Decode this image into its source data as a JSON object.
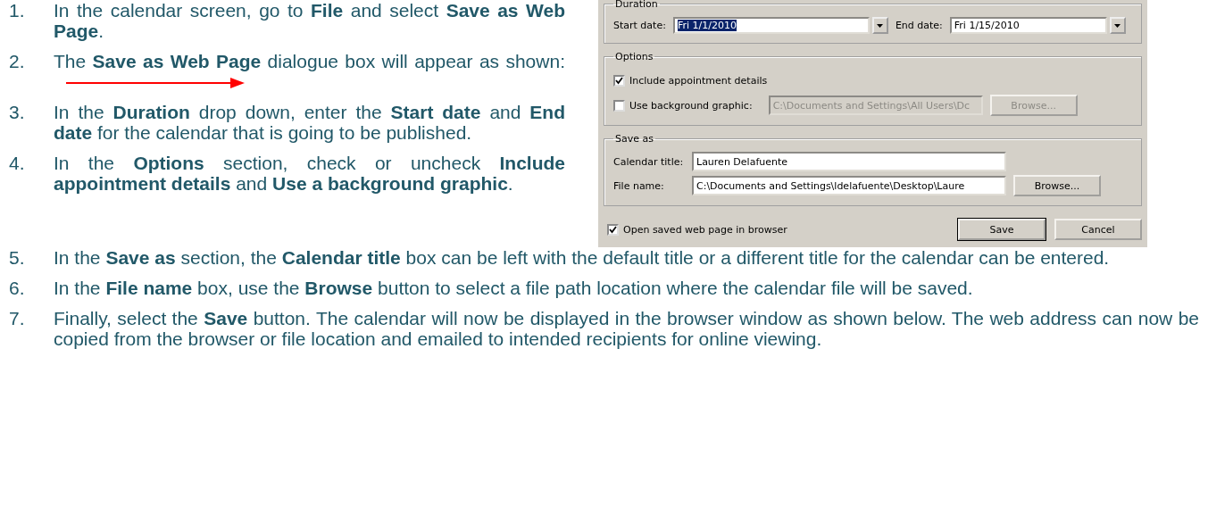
{
  "steps_beside_dialog": [
    {
      "number": "1.",
      "text": "In the calendar screen, go to **File** and select **Save as Web Page**."
    },
    {
      "number": "2.",
      "text": "The **Save as Web Page** dialogue box will appear as shown:",
      "arrow": true
    },
    {
      "number": "3.",
      "text": "In the **Duration** drop down, enter the **Start date** and **End date** for the calendar that is going to be published."
    },
    {
      "number": "4.",
      "text": "In the **Options** section, check or uncheck **Include appointment details** and **Use a background graphic**."
    }
  ],
  "dialog": {
    "duration": {
      "legend": "Duration",
      "start_label": "Start date:",
      "start_value": "Fri 1/1/2010",
      "start_selected": true,
      "end_label": "End date:",
      "end_value": "Fri 1/15/2010",
      "end_selected": false
    },
    "options": {
      "legend": "Options",
      "items": [
        {
          "kind": "checkbox",
          "label": "Include appointment details",
          "checked": true
        },
        {
          "kind": "checkbox_path",
          "label": "Use background graphic:",
          "checked": false,
          "value": "C:\\Documents and Settings\\All Users\\Dc",
          "button": "Browse...",
          "disabled": true
        }
      ]
    },
    "save_as": {
      "legend": "Save as",
      "title_label": "Calendar title:",
      "title_value": "Lauren Delafuente",
      "file_label": "File name:",
      "file_value": "C:\\Documents and Settings\\ldelafuente\\Desktop\\Laure",
      "browse": "Browse..."
    },
    "open_in_browser": {
      "label": "Open saved web page in browser",
      "checked": true
    },
    "buttons": [
      "Save",
      "Cancel"
    ]
  },
  "steps_below_dialog": [
    {
      "number": "5.",
      "text": "In the **Save as** section, the **Calendar title** box can be left with the default title or a different title for the calendar can be entered."
    },
    {
      "number": "6.",
      "text": "In the **File name** box, use the **Browse** button to select a file path location where the calendar file will be saved."
    },
    {
      "number": "7.",
      "text": "Finally, select the **Save** button.  The calendar will now be displayed in the browser window as shown below.  The web address can now be copied from the browser or file location and emailed to intended recipients for online viewing."
    }
  ]
}
